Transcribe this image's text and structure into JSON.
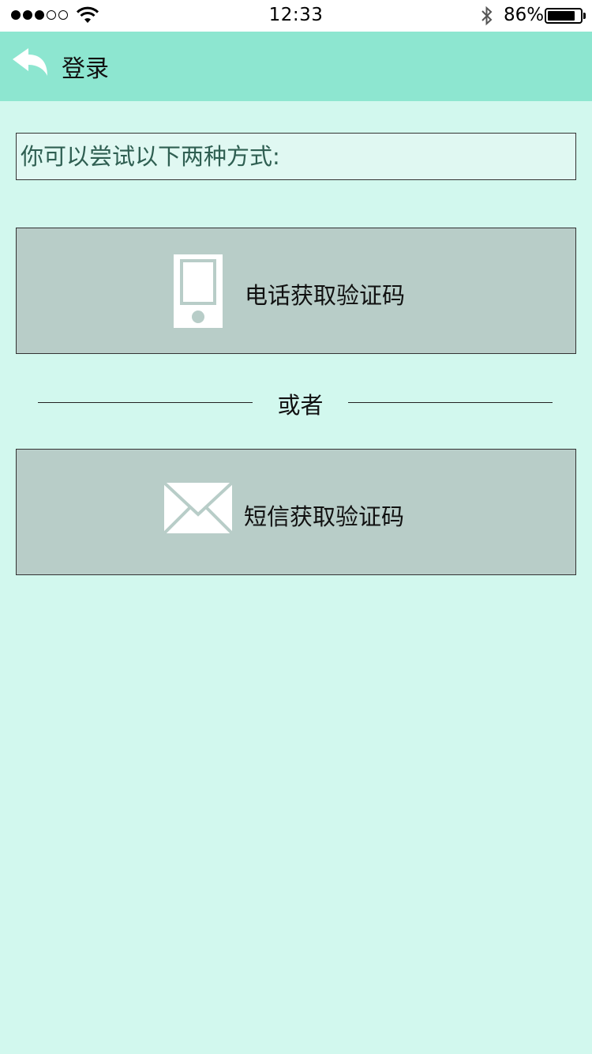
{
  "status_bar": {
    "signal_bars": 3,
    "signal_total": 5,
    "time": "12:33",
    "battery_percent": "86%",
    "battery_level": 0.86,
    "icons": [
      "signal-dots-icon",
      "wifi-icon",
      "bluetooth-icon",
      "battery-icon"
    ]
  },
  "nav": {
    "title": "登录",
    "back_icon": "back-arrow-icon"
  },
  "hint": {
    "text": "你可以尝试以下两种方式:"
  },
  "options": {
    "phone": {
      "label": "电话获取验证码",
      "icon": "phone-icon"
    },
    "separator": "或者",
    "sms": {
      "label": "短信获取验证码",
      "icon": "mail-icon"
    }
  },
  "colors": {
    "background": "#d2f8ee",
    "nav_bar": "#8de6d0",
    "button_bg": "#b8cdc8",
    "hint_bg": "#e0f8f2",
    "hint_text": "#2f5f52",
    "icon": "#ffffff"
  }
}
